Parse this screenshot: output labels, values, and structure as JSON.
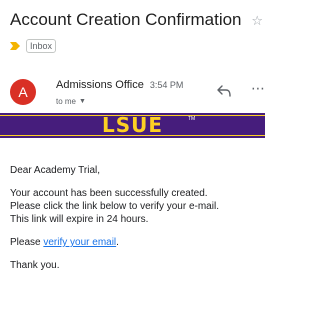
{
  "email": {
    "subject": "Account Creation Confirmation",
    "label": "Inbox",
    "sender": "Admissions Office",
    "time": "3:54 PM",
    "recipient": "to me",
    "banner_logo": "LSUE",
    "greeting": "Dear Academy Trial,",
    "paragraph_lines": [
      "Your account has been successfully created.",
      "Please click the link below to verify your e-mail.",
      "This link will expire in 24 hours."
    ],
    "verify_prefix": "Please ",
    "verify_link": "verify your email",
    "verify_suffix": ".",
    "closing": "Thank you."
  },
  "colors": {
    "banner": "#461d7c",
    "logo": "#fdd023",
    "avatar": "#d93025",
    "link": "#1a73e8"
  },
  "icons": {
    "avatar_letter": "A",
    "star": "star-icon",
    "reply": "reply-icon",
    "more": "more-icon"
  }
}
